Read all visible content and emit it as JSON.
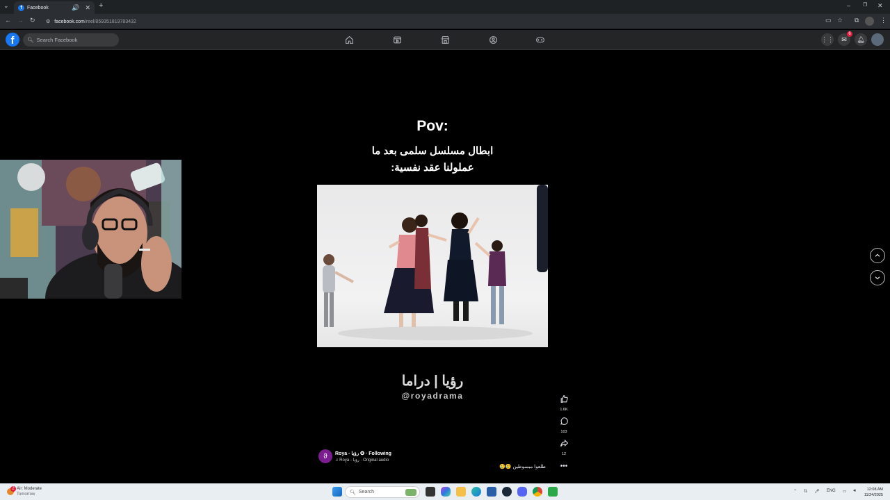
{
  "browser": {
    "tab_title": "Facebook",
    "url_domain": "facebook.com",
    "url_path": "/reel/859351819783432",
    "icons": [
      "back-icon",
      "forward-icon",
      "reload-icon",
      "site-info-icon",
      "cast-icon",
      "star-icon",
      "extensions-icon",
      "profile-icon",
      "menu-icon",
      "speaker-icon",
      "close-icon",
      "new-tab-icon"
    ]
  },
  "facebook": {
    "search_placeholder": "Search Facebook",
    "nav": [
      "home",
      "video",
      "marketplace",
      "groups",
      "gaming"
    ],
    "messenger_badge": "6",
    "colors": {
      "brand": "#1877f2",
      "header": "#242526",
      "badge": "#e41e3f"
    }
  },
  "reel": {
    "title": "Pov:",
    "subtitle_line1": "ابطال مسلسل سلمى بعد ما",
    "subtitle_line2": "عملولنا عقد نفسية:",
    "brand_arabic": "رؤيا | دراما",
    "brand_handle": "@royadrama",
    "likes": "1.6K",
    "comments": "103",
    "shares": "12",
    "author": "Roya - رؤيا",
    "verified_mark": "✪",
    "following": "· Following",
    "audio": "Roya - رؤيا · Original audio",
    "caption": "طلعوا مبسوطين 🥲🥲"
  },
  "taskbar": {
    "weather_title": "Air: Moderate",
    "weather_sub": "Tomorrow",
    "weather_badge": "2",
    "search_label": "Search",
    "lang": "ENG",
    "time": "12:08 AM",
    "date": "11/24/2025"
  }
}
